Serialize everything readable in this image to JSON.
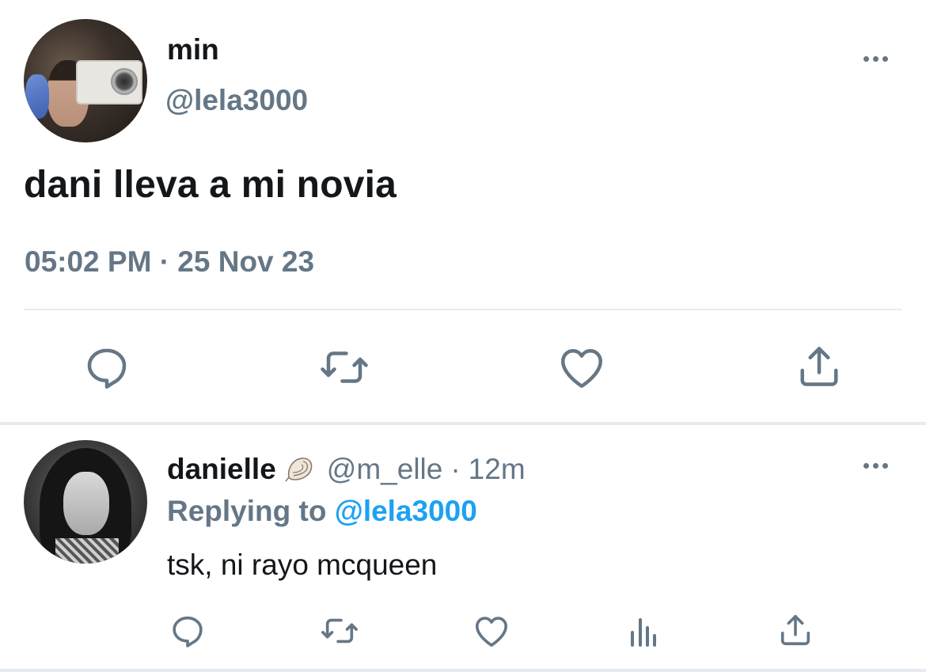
{
  "colors": {
    "text": "#14171a",
    "secondary": "#657786",
    "accent": "#1da1f2",
    "divider": "#e6ecf0"
  },
  "main_tweet": {
    "author_name": "min",
    "author_handle": "@lela3000",
    "text": "dani lleva a mi novia",
    "timestamp": "05:02 PM · 25 Nov 23",
    "more_icon": "more-horizontal-icon",
    "actions": [
      {
        "name": "reply",
        "icon": "comment-icon"
      },
      {
        "name": "retweet",
        "icon": "retweet-icon"
      },
      {
        "name": "like",
        "icon": "heart-icon"
      },
      {
        "name": "share",
        "icon": "share-icon"
      }
    ]
  },
  "reply": {
    "author_name": "danielle",
    "author_badge_icon": "seashell-icon",
    "author_handle": "@m_elle",
    "separator": "·",
    "time": "12m",
    "replying_label": "Replying to",
    "replying_mention": "@lela3000",
    "text": "tsk, ni rayo mcqueen",
    "more_icon": "more-horizontal-icon",
    "actions": [
      {
        "name": "reply",
        "icon": "comment-icon"
      },
      {
        "name": "retweet",
        "icon": "retweet-icon"
      },
      {
        "name": "like",
        "icon": "heart-icon"
      },
      {
        "name": "analytics",
        "icon": "bar-chart-icon"
      },
      {
        "name": "share",
        "icon": "share-icon"
      }
    ]
  }
}
